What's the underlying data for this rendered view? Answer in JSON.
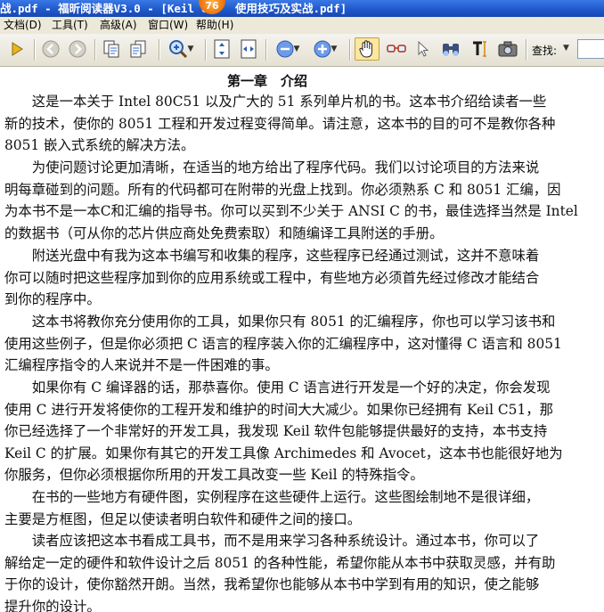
{
  "window": {
    "title_left": "战.pdf - 福昕阅读器V3.0 - [Keil C",
    "title_right": "使用技巧及实战.pdf]",
    "badge": "76"
  },
  "menu": [
    "文档(D)",
    "工具(T)",
    "高级(A)",
    "窗口(W)",
    "帮助(H)"
  ],
  "toolbar": {
    "icons": [
      "open-icon",
      "back-icon",
      "forward-icon",
      "copy-page-icon",
      "paste-page-icon",
      "zoom-in-icon",
      "fit-page-icon",
      "fit-width-icon",
      "zoom-out-minus-icon",
      "zoom-in-plus-icon",
      "hand-tool-icon",
      "glasses-icon",
      "select-arrow-icon",
      "binoculars-icon",
      "text-select-icon",
      "snapshot-camera-icon"
    ],
    "search_label": "查找:",
    "search_value": ""
  },
  "document": {
    "chapter_title": "第一章　介绍",
    "paragraphs": [
      [
        "　　这是一本关于 Intel 80C51 以及广大的 51 系列单片机的书。这本书介绍给读者一些",
        "新的技术，使你的 8051 工程和开发过程变得简单。请注意，这本书的目的可不是教你各种",
        "8051 嵌入式系统的解决方法。"
      ],
      [
        "　　为使问题讨论更加清晰，在适当的地方给出了程序代码。我们以讨论项目的方法来说",
        "明每章碰到的问题。所有的代码都可在附带的光盘上找到。你必须熟系 C 和 8051 汇编，因",
        "为本书不是一本C和汇编的指导书。你可以买到不少关于 ANSI C 的书，最佳选择当然是 Intel",
        "的数据书（可从你的芯片供应商处免费索取）和随编译工具附送的手册。"
      ],
      [
        "　　附送光盘中有我为这本书编写和收集的程序，这些程序已经通过测试，这并不意味着",
        "你可以随时把这些程序加到你的应用系统或工程中，有些地方必须首先经过修改才能结合",
        "到你的程序中。"
      ],
      [
        "　　这本书将教你充分使用你的工具，如果你只有 8051 的汇编程序，你也可以学习该书和",
        "使用这些例子，但是你必须把 C 语言的程序装入你的汇编程序中，这对懂得 C 语言和 8051",
        "汇编程序指令的人来说并不是一件困难的事。"
      ],
      [
        "　　如果你有 C 编译器的话，那恭喜你。使用 C 语言进行开发是一个好的决定，你会发现",
        "使用 C 进行开发将使你的工程开发和维护的时间大大减少。如果你已经拥有 Keil C51，那",
        "你已经选择了一个非常好的开发工具，我发现 Keil 软件包能够提供最好的支持，本书支持",
        "Keil C 的扩展。如果你有其它的开发工具像 Archimedes 和 Avocet，这本书也能很好地为",
        "你服务，但你必须根据你所用的开发工具改变一些 Keil 的特殊指令。"
      ],
      [
        "　　在书的一些地方有硬件图，实例程序在这些硬件上运行。这些图绘制地不是很详细，",
        "主要是方框图，但足以使读者明白软件和硬件之间的接口。"
      ],
      [
        "　　读者应该把这本书看成工具书，而不是用来学习各种系统设计。通过本书，你可以了",
        "解给定一定的硬件和软件设计之后 8051 的各种性能，希望你能从本书中获取灵感，并有助",
        "于你的设计，使你豁然开朗。当然，我希望你也能够从本书中学到有用的知识，使之能够",
        "提升你的设计。"
      ]
    ]
  },
  "colors": {
    "titlebar": "#1e56c8",
    "menubar": "#ece9d8",
    "toolbar": "#e9e6d8",
    "badge": "#f07a10",
    "text": "#111111"
  }
}
